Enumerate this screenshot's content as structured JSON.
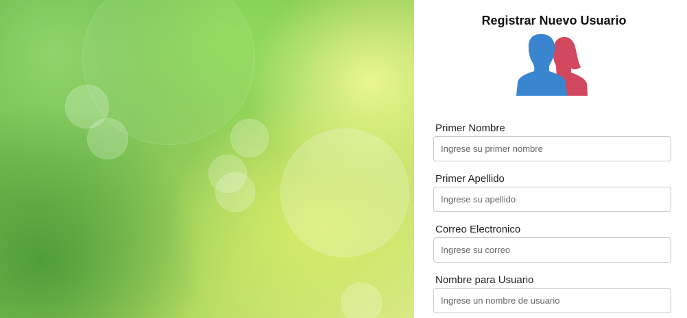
{
  "form": {
    "title": "Registrar Nuevo Usuario",
    "icon": "users-icon",
    "colors": {
      "user_blue": "#3a85cf",
      "user_red": "#d2485f"
    },
    "fields": [
      {
        "label": "Primer Nombre",
        "placeholder": "Ingrese su primer nombre",
        "value": ""
      },
      {
        "label": "Primer Apellido",
        "placeholder": "Ingrese su apellido",
        "value": ""
      },
      {
        "label": "Correo Electronico",
        "placeholder": "Ingrese su correo",
        "value": ""
      },
      {
        "label": "Nombre para Usuario",
        "placeholder": "Ingrese un nombre de usuario",
        "value": ""
      }
    ]
  },
  "background": {
    "description_color": "#7cc253"
  }
}
